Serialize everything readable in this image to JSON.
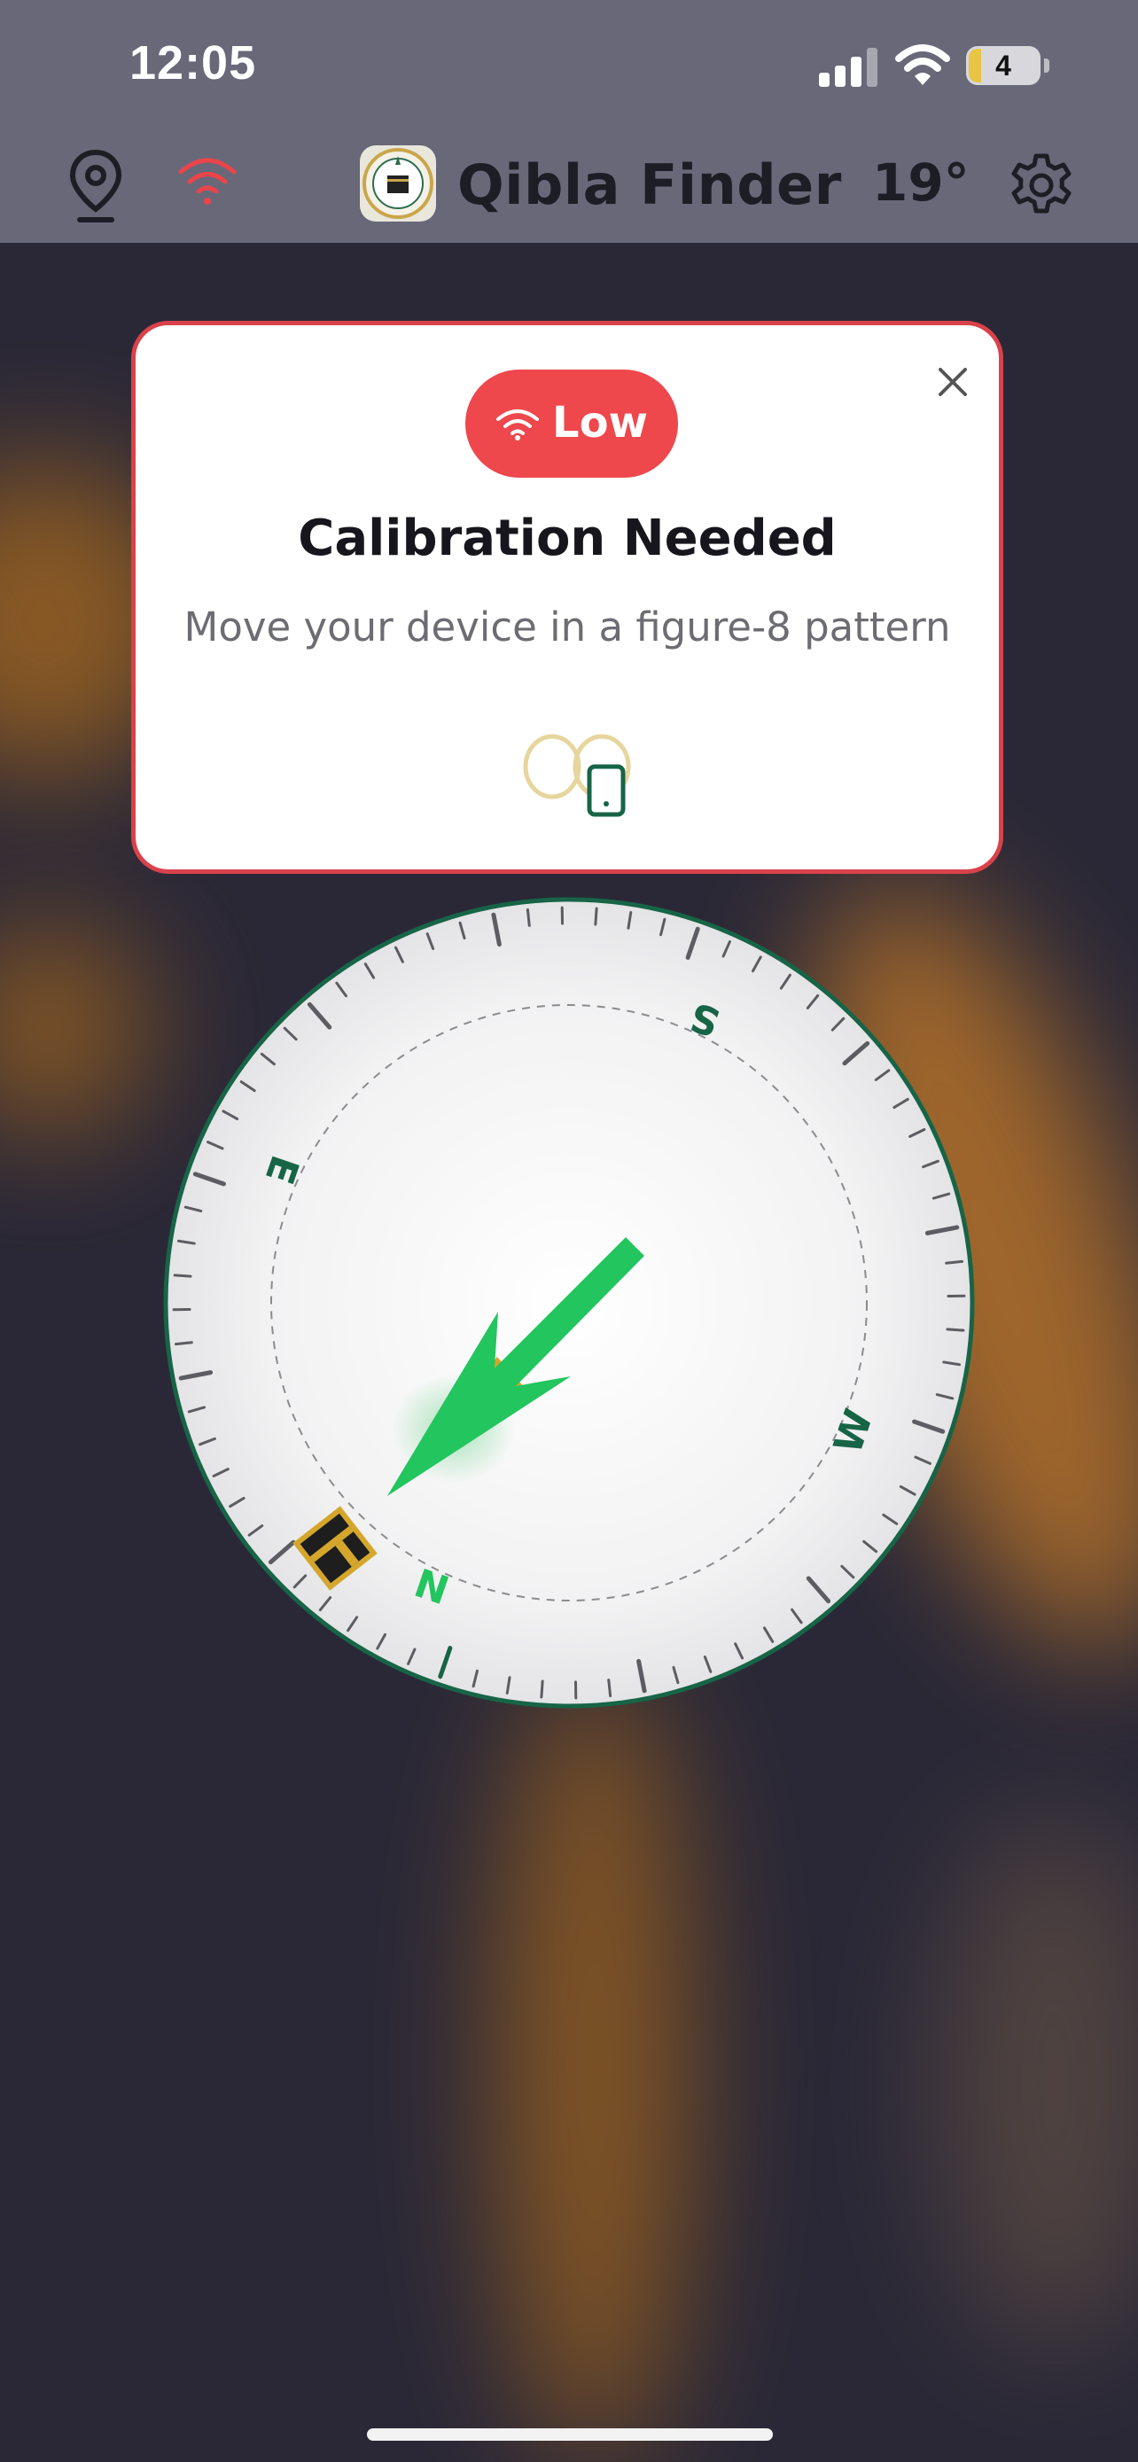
{
  "status_bar": {
    "time": "12:05",
    "battery_level": "4",
    "icons": [
      "cellular-signal-icon",
      "wifi-icon",
      "battery-icon"
    ]
  },
  "nav": {
    "title": "Qibla Finder",
    "heading": "19°",
    "icons": [
      "location-pin-icon",
      "wifi-icon",
      "app-logo",
      "settings-gear-icon"
    ]
  },
  "calibration": {
    "accuracy_label": "Low",
    "title": "Calibration Needed",
    "message": "Move your device in a figure-8 pattern",
    "accent_color": "#ee474c"
  },
  "compass": {
    "cardinals": {
      "n": "N",
      "e": "E",
      "s": "S",
      "w": "W"
    },
    "heading_degrees": 19,
    "ring_color": "#176447",
    "needle_color": "#22c55e",
    "qibla_color": "#d4a72c"
  }
}
